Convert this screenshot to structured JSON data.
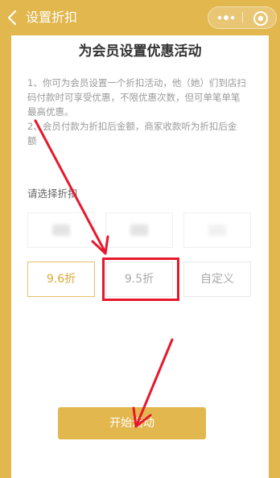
{
  "header": {
    "title": "设置折扣",
    "back_icon": "chevron-left-icon",
    "more_icon": "more-dots-icon",
    "close_icon": "target-circle-icon"
  },
  "card": {
    "title": "为会员设置优惠活动",
    "notes": [
      "1、你可为会员设置一个折扣活动，他（她）们到店扫",
      "码付款时可享受优惠，不限优惠次数，但可单笔单笔",
      "最高优惠。",
      "2、会员付款为折扣后金额，商家收款听为折扣后金",
      "额"
    ],
    "select_label": "请选择折扣"
  },
  "discount_options": {
    "row2": [
      "9.6折",
      "9.5折",
      "自定义"
    ]
  },
  "actions": {
    "start_label": "开始活动"
  },
  "colors": {
    "brand": "#E2B74E",
    "selected_text": "#D9A93A",
    "annotation_red": "#E7182C"
  }
}
